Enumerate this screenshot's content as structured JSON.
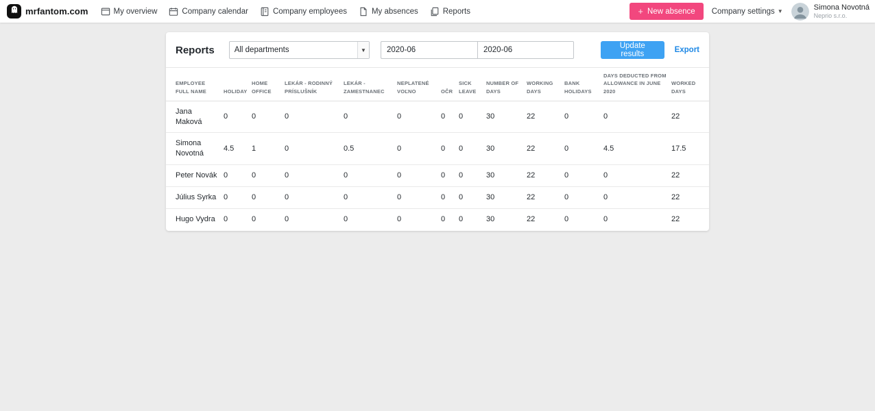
{
  "colors": {
    "accent_pink": "#f2477e",
    "primary_blue": "#3ea2f3",
    "link_blue": "#1e88e5",
    "page_background": "#ececec"
  },
  "navbar": {
    "brand": "mrfantom.com",
    "items": [
      {
        "label": "My overview"
      },
      {
        "label": "Company calendar"
      },
      {
        "label": "Company employees"
      },
      {
        "label": "My absences"
      },
      {
        "label": "Reports"
      }
    ],
    "new_absence_plus": "+",
    "new_absence_button": "New absence",
    "company_settings": "Company settings",
    "user": {
      "name": "Simona Novotná",
      "company": "Neprio s.r.o."
    }
  },
  "reports": {
    "title": "Reports",
    "department_select": "All departments",
    "period_from": "2020-06",
    "period_to": "2020-06",
    "update_button": "Update results",
    "export_link": "Export"
  },
  "table": {
    "headers": [
      "EMPLOYEE FULL NAME",
      "HOLIDAY",
      "HOME OFFICE",
      "LEKÁR - RODINNÝ PRÍSLUŠNÍK",
      "LEKÁR - ZAMESTNANEC",
      "NEPLATENÉ VOĽNO",
      "OČR",
      "SICK LEAVE",
      "NUMBER OF DAYS",
      "WORKING DAYS",
      "BANK HOLIDAYS",
      "DAYS DEDUCTED FROM ALLOWANCE IN JUNE 2020",
      "WORKED DAYS"
    ],
    "rows": [
      {
        "cells": [
          "Jana Maková",
          "0",
          "0",
          "0",
          "0",
          "0",
          "0",
          "0",
          "30",
          "22",
          "0",
          "0",
          "22"
        ]
      },
      {
        "cells": [
          "Simona Novotná",
          "4.5",
          "1",
          "0",
          "0.5",
          "0",
          "0",
          "0",
          "30",
          "22",
          "0",
          "4.5",
          "17.5"
        ]
      },
      {
        "cells": [
          "Peter Novák",
          "0",
          "0",
          "0",
          "0",
          "0",
          "0",
          "0",
          "30",
          "22",
          "0",
          "0",
          "22"
        ]
      },
      {
        "cells": [
          "Július Syrka",
          "0",
          "0",
          "0",
          "0",
          "0",
          "0",
          "0",
          "30",
          "22",
          "0",
          "0",
          "22"
        ]
      },
      {
        "cells": [
          "Hugo Vydra",
          "0",
          "0",
          "0",
          "0",
          "0",
          "0",
          "0",
          "30",
          "22",
          "0",
          "0",
          "22"
        ]
      }
    ]
  }
}
